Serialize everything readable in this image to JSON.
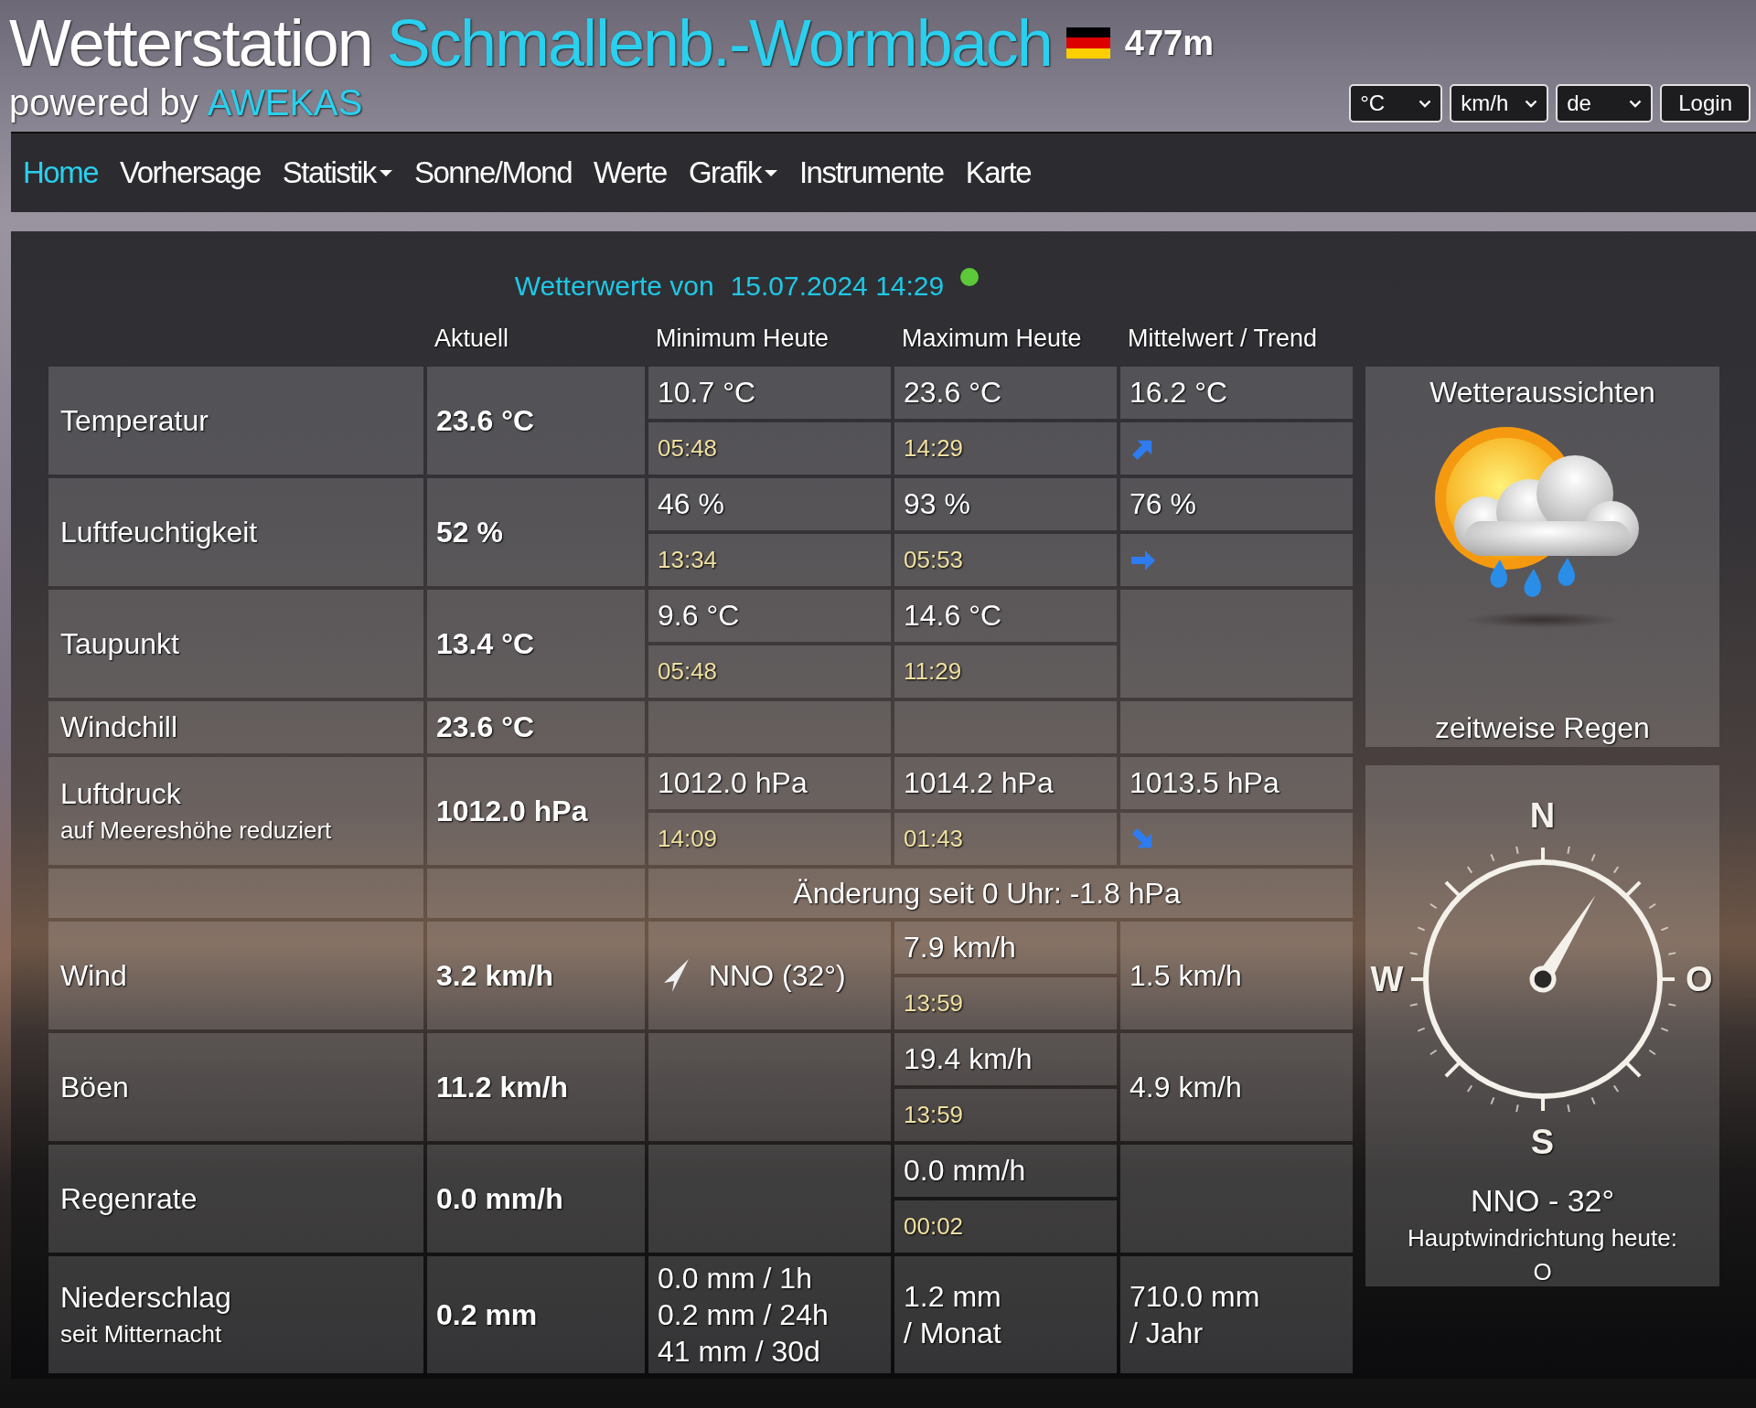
{
  "header": {
    "title": "Wetterstation",
    "station": "Schmallenb.-Wormbach",
    "altitude": "477m",
    "powered_by": "powered by",
    "brand": "AWEKAS"
  },
  "controls": {
    "selects": [
      {
        "value": "°C"
      },
      {
        "value": "km/h"
      },
      {
        "value": "de"
      }
    ],
    "login": "Login"
  },
  "nav": [
    {
      "label": "Home",
      "selected": true,
      "has_menu": false
    },
    {
      "label": "Vorhersage",
      "selected": false,
      "has_menu": false
    },
    {
      "label": "Statistik",
      "selected": false,
      "has_menu": true
    },
    {
      "label": "Sonne/Mond",
      "selected": false,
      "has_menu": false
    },
    {
      "label": "Werte",
      "selected": false,
      "has_menu": false
    },
    {
      "label": "Grafik",
      "selected": false,
      "has_menu": true
    },
    {
      "label": "Instrumente",
      "selected": false,
      "has_menu": false
    },
    {
      "label": "Karte",
      "selected": false,
      "has_menu": false
    }
  ],
  "timestamp": {
    "label": "Wetterwerte von",
    "value": "15.07.2024 14:29",
    "color": "#5cc83a"
  },
  "table": {
    "columns": [
      "Aktuell",
      "Minimum Heute",
      "Maximum Heute",
      "Mittelwert / Trend"
    ],
    "rows": [
      {
        "kind": "data",
        "label": "Temperatur",
        "current": "23.6 °C",
        "cells": [
          {
            "kind": "split",
            "value": "10.7 °C",
            "time": "05:48"
          },
          {
            "kind": "split",
            "value": "23.6 °C",
            "time": "14:29"
          },
          {
            "kind": "trend_up",
            "value": "16.2 °C"
          }
        ]
      },
      {
        "kind": "data",
        "label": "Luftfeuchtigkeit",
        "current": "52 %",
        "cells": [
          {
            "kind": "split",
            "value": "46 %",
            "time": "13:34"
          },
          {
            "kind": "split",
            "value": "93 %",
            "time": "05:53"
          },
          {
            "kind": "trend_flat",
            "value": "76 %"
          }
        ]
      },
      {
        "kind": "data",
        "label": "Taupunkt",
        "current": "13.4 °C",
        "cells": [
          {
            "kind": "split",
            "value": "9.6 °C",
            "time": "05:48"
          },
          {
            "kind": "split",
            "value": "14.6 °C",
            "time": "11:29"
          },
          {
            "kind": "empty"
          }
        ]
      },
      {
        "kind": "data",
        "label": "Windchill",
        "current": "23.6 °C",
        "cells": [
          {
            "kind": "empty"
          },
          {
            "kind": "empty"
          },
          {
            "kind": "empty"
          }
        ]
      },
      {
        "kind": "data",
        "label": "Luftdruck",
        "sublabel": "auf Meereshöhe reduziert",
        "current": "1012.0 hPa",
        "cells": [
          {
            "kind": "split",
            "value": "1012.0 hPa",
            "time": "14:09"
          },
          {
            "kind": "split",
            "value": "1014.2 hPa",
            "time": "01:43"
          },
          {
            "kind": "trend_down",
            "value": "1013.5 hPa"
          }
        ]
      },
      {
        "kind": "note",
        "text": "Änderung seit 0 Uhr: -1.8 hPa"
      },
      {
        "kind": "data",
        "label": "Wind",
        "current": "3.2 km/h",
        "cells": [
          {
            "kind": "direction",
            "value": "NNO (32°)"
          },
          {
            "kind": "split",
            "value": "7.9 km/h",
            "time": "13:59"
          },
          {
            "kind": "text",
            "value": "1.5 km/h"
          }
        ]
      },
      {
        "kind": "data",
        "label": "Böen",
        "current": "11.2 km/h",
        "cells": [
          {
            "kind": "empty"
          },
          {
            "kind": "split",
            "value": "19.4 km/h",
            "time": "13:59"
          },
          {
            "kind": "text",
            "value": "4.9 km/h"
          }
        ]
      },
      {
        "kind": "data",
        "label": "Regenrate",
        "current": "0.0 mm/h",
        "cells": [
          {
            "kind": "empty"
          },
          {
            "kind": "split",
            "value": "0.0 mm/h",
            "time": "00:02"
          },
          {
            "kind": "empty"
          }
        ]
      },
      {
        "kind": "data",
        "label": "Niederschlag",
        "sublabel": "seit Mitternacht",
        "current": "0.2 mm",
        "cells": [
          {
            "kind": "lines",
            "lines": [
              "0.0 mm / 1h",
              "0.2 mm / 24h",
              "41 mm / 30d"
            ]
          },
          {
            "kind": "lines",
            "lines": [
              "1.2 mm",
              "/ Monat"
            ]
          },
          {
            "kind": "lines",
            "lines": [
              "710.0 mm",
              "/ Jahr"
            ]
          }
        ]
      }
    ]
  },
  "forecast": {
    "title": "Wetteraussichten",
    "text": "zeitweise Regen"
  },
  "wind_compass": {
    "labels": [
      "N",
      "W",
      "O",
      "S"
    ],
    "direction": "NNO -  32°",
    "main_label": "Hauptwindrichtung heute:",
    "main_value": "O"
  }
}
